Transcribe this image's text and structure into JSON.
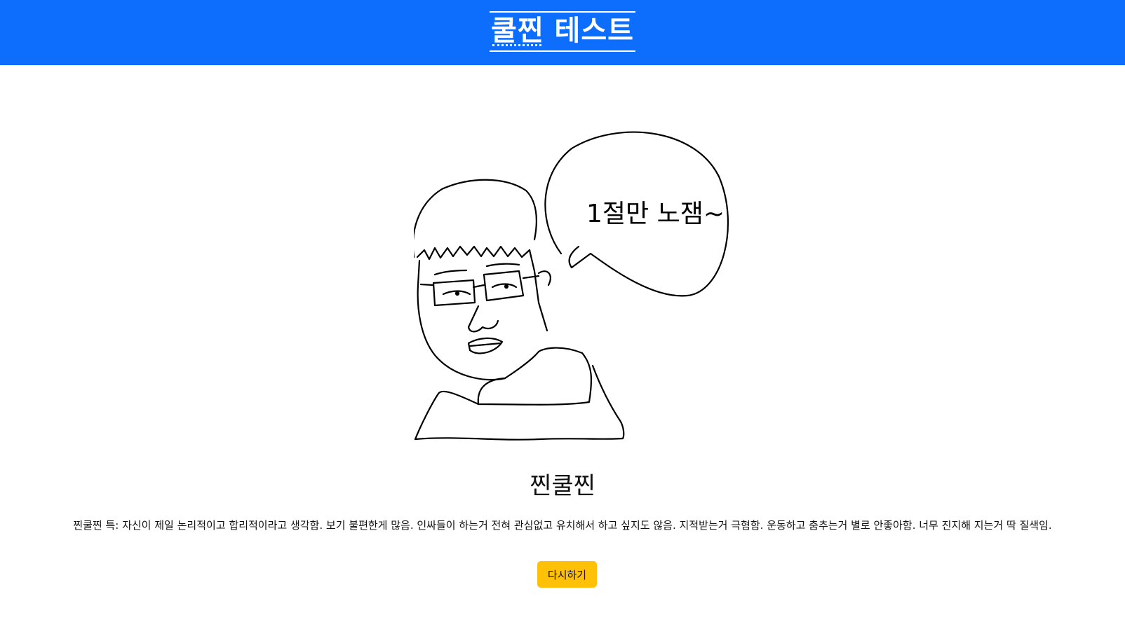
{
  "header": {
    "title": "쿨찐 테스트",
    "background_color": "#0d6efd"
  },
  "illustration": {
    "speech_bubble_text": "1절만 노잼~"
  },
  "result": {
    "title": "찐쿨찐",
    "description": "찐쿨찐 특: 자신이 제일 논리적이고 합리적이라고 생각함. 보기 불편한게 많음. 인싸들이 하는거 전혀 관심없고 유치해서 하고 싶지도 않음. 지적받는거 극혐함. 운동하고 춤추는거 별로 안좋아함. 너무 진지해 지는거 딱 질색임."
  },
  "actions": {
    "retry_label": "다시하기",
    "retry_color": "#ffc107"
  }
}
